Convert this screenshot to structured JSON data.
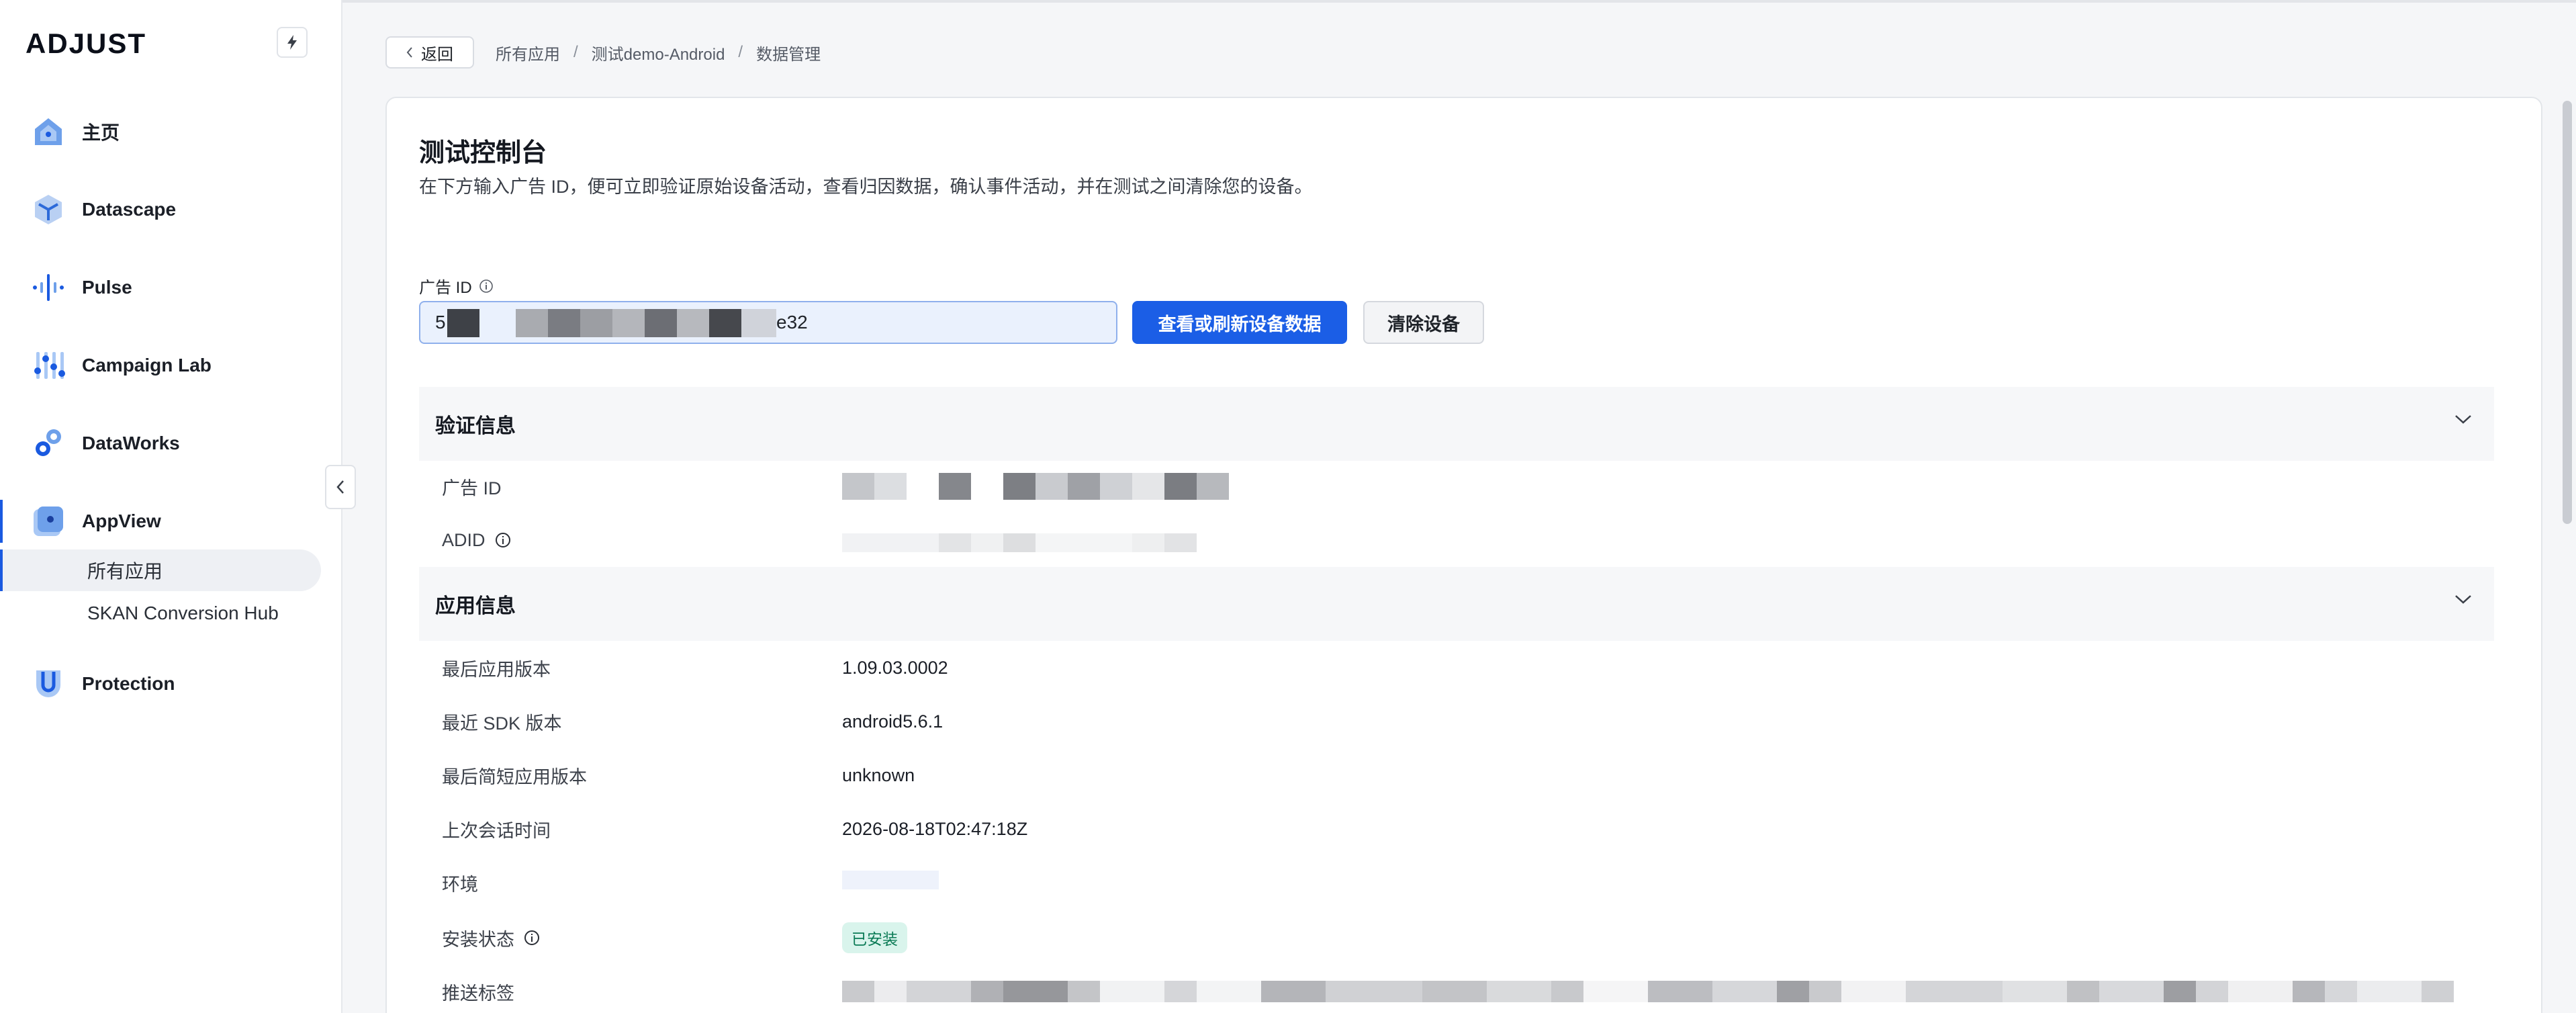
{
  "brand": {
    "logo_text": "ADJUST"
  },
  "sidebar": {
    "items": [
      {
        "label": "主页",
        "icon": "home-icon"
      },
      {
        "label": "Datascape",
        "icon": "datascape-icon"
      },
      {
        "label": "Pulse",
        "icon": "pulse-icon"
      },
      {
        "label": "Campaign Lab",
        "icon": "campaign-lab-icon"
      },
      {
        "label": "DataWorks",
        "icon": "dataworks-icon"
      },
      {
        "label": "AppView",
        "icon": "appview-icon"
      },
      {
        "label": "Protection",
        "icon": "protection-icon"
      }
    ],
    "sub_items": [
      {
        "label": "所有应用"
      },
      {
        "label": "SKAN Conversion Hub"
      }
    ]
  },
  "header": {
    "back_label": "返回",
    "breadcrumb": [
      "所有应用",
      "测试demo-Android",
      "数据管理"
    ]
  },
  "main": {
    "title": "测试控制台",
    "description": "在下方输入广告 ID，便可立即验证原始设备活动，查看归因数据，确认事件活动，并在测试之间清除您的设备。",
    "ad_id_label": "广告 ID",
    "ad_id_value_start": "5",
    "ad_id_value_end": "e32",
    "refresh_button": "查看或刷新设备数据",
    "clear_button": "清除设备"
  },
  "verification": {
    "title": "验证信息",
    "rows": [
      {
        "label": "广告 ID"
      },
      {
        "label": "ADID"
      }
    ]
  },
  "app_info": {
    "title": "应用信息",
    "rows": [
      {
        "label": "最后应用版本",
        "value": "1.09.03.0002"
      },
      {
        "label": "最近 SDK 版本",
        "value": "android5.6.1"
      },
      {
        "label": "最后简短应用版本",
        "value": "unknown"
      },
      {
        "label": "上次会话时间",
        "value": "2026-08-18T02:47:18Z"
      },
      {
        "label": "环境",
        "value": ""
      },
      {
        "label": "安装状态",
        "value": "已安装"
      },
      {
        "label": "推送标签",
        "value": ""
      }
    ]
  },
  "colors": {
    "primary": "#1b5ee6",
    "active_indicator": "#1a5ae0",
    "badge_bg": "#d9f4ec",
    "badge_text": "#0a7a55"
  }
}
